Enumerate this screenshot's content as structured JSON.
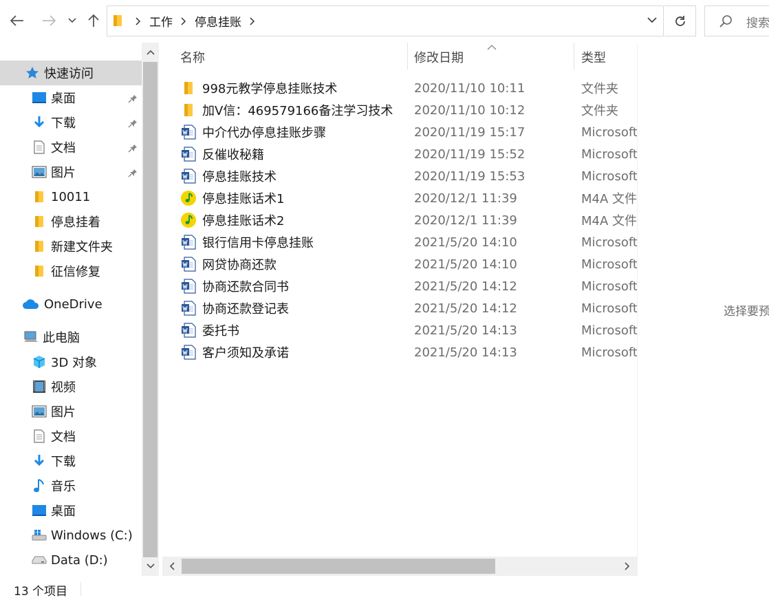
{
  "nav_buttons": {
    "back": "back-arrow-icon",
    "forward": "forward-arrow-icon",
    "recent": "chevron-down-icon",
    "up": "up-arrow-icon"
  },
  "address": {
    "breadcrumbs": [
      "工作",
      "停息挂账"
    ]
  },
  "search": {
    "placeholder": "搜索"
  },
  "navigation": {
    "items": [
      {
        "label": "快速访问",
        "icon": "star-icon"
      },
      {
        "label": "桌面",
        "icon": "desktop-icon",
        "pinned": true
      },
      {
        "label": "下载",
        "icon": "download-icon",
        "pinned": true
      },
      {
        "label": "文档",
        "icon": "document-icon",
        "pinned": true
      },
      {
        "label": "图片",
        "icon": "picture-icon",
        "pinned": true
      },
      {
        "label": "10011",
        "icon": "folder-icon"
      },
      {
        "label": "停息挂着",
        "icon": "folder-icon"
      },
      {
        "label": "新建文件夹",
        "icon": "folder-icon"
      },
      {
        "label": "征信修复",
        "icon": "folder-icon"
      },
      {
        "label": "OneDrive",
        "icon": "cloud-icon"
      },
      {
        "label": "此电脑",
        "icon": "computer-icon"
      },
      {
        "label": "3D 对象",
        "icon": "cube-icon"
      },
      {
        "label": "视频",
        "icon": "video-icon"
      },
      {
        "label": "图片",
        "icon": "picture-icon"
      },
      {
        "label": "文档",
        "icon": "document-icon"
      },
      {
        "label": "下载",
        "icon": "download-icon"
      },
      {
        "label": "音乐",
        "icon": "music-icon"
      },
      {
        "label": "桌面",
        "icon": "desktop-icon"
      },
      {
        "label": "Windows (C:)",
        "icon": "windows-drive-icon"
      },
      {
        "label": "Data (D:)",
        "icon": "drive-icon"
      }
    ]
  },
  "columns": {
    "name": "名称",
    "date": "修改日期",
    "type": "类型"
  },
  "files": [
    {
      "name": "998元教学停息挂账技术",
      "date": "2020/11/10 10:11",
      "type": "文件夹",
      "icon": "folder-icon"
    },
    {
      "name": "加V信：469579166备注学习技术",
      "date": "2020/11/10 10:12",
      "type": "文件夹",
      "icon": "folder-icon"
    },
    {
      "name": "中介代办停息挂账步骤",
      "date": "2020/11/19 15:17",
      "type": "Microsoft",
      "icon": "word-doc-icon"
    },
    {
      "name": "反催收秘籍",
      "date": "2020/11/19 15:52",
      "type": "Microsoft",
      "icon": "word-doc-icon"
    },
    {
      "name": "停息挂账技术",
      "date": "2020/11/19 15:53",
      "type": "Microsoft",
      "icon": "word-doc-icon"
    },
    {
      "name": "停息挂账话术1",
      "date": "2020/12/1 11:39",
      "type": "M4A 文件",
      "icon": "audio-file-icon"
    },
    {
      "name": "停息挂账话术2",
      "date": "2020/12/1 11:39",
      "type": "M4A 文件",
      "icon": "audio-file-icon"
    },
    {
      "name": "银行信用卡停息挂账",
      "date": "2021/5/20 14:10",
      "type": "Microsoft",
      "icon": "word-doc-icon"
    },
    {
      "name": "网贷协商还款",
      "date": "2021/5/20 14:10",
      "type": "Microsoft",
      "icon": "word-doc-icon"
    },
    {
      "name": "协商还款合同书",
      "date": "2021/5/20 14:12",
      "type": "Microsoft",
      "icon": "word-doc-icon"
    },
    {
      "name": "协商还款登记表",
      "date": "2021/5/20 14:12",
      "type": "Microsoft",
      "icon": "word-doc-icon"
    },
    {
      "name": "委托书",
      "date": "2021/5/20 14:13",
      "type": "Microsoft",
      "icon": "word-doc-icon"
    },
    {
      "name": "客户须知及承诺",
      "date": "2021/5/20 14:13",
      "type": "Microsoft",
      "icon": "word-doc-icon"
    }
  ],
  "preview": {
    "message": "选择要预"
  },
  "status": {
    "count": "13 个项目"
  },
  "colors": {
    "accent": "#0078d7",
    "selected_bg": "#cce8ff",
    "folder": "#ffc83d",
    "word": "#2b579a",
    "audio": "#f5d400"
  }
}
